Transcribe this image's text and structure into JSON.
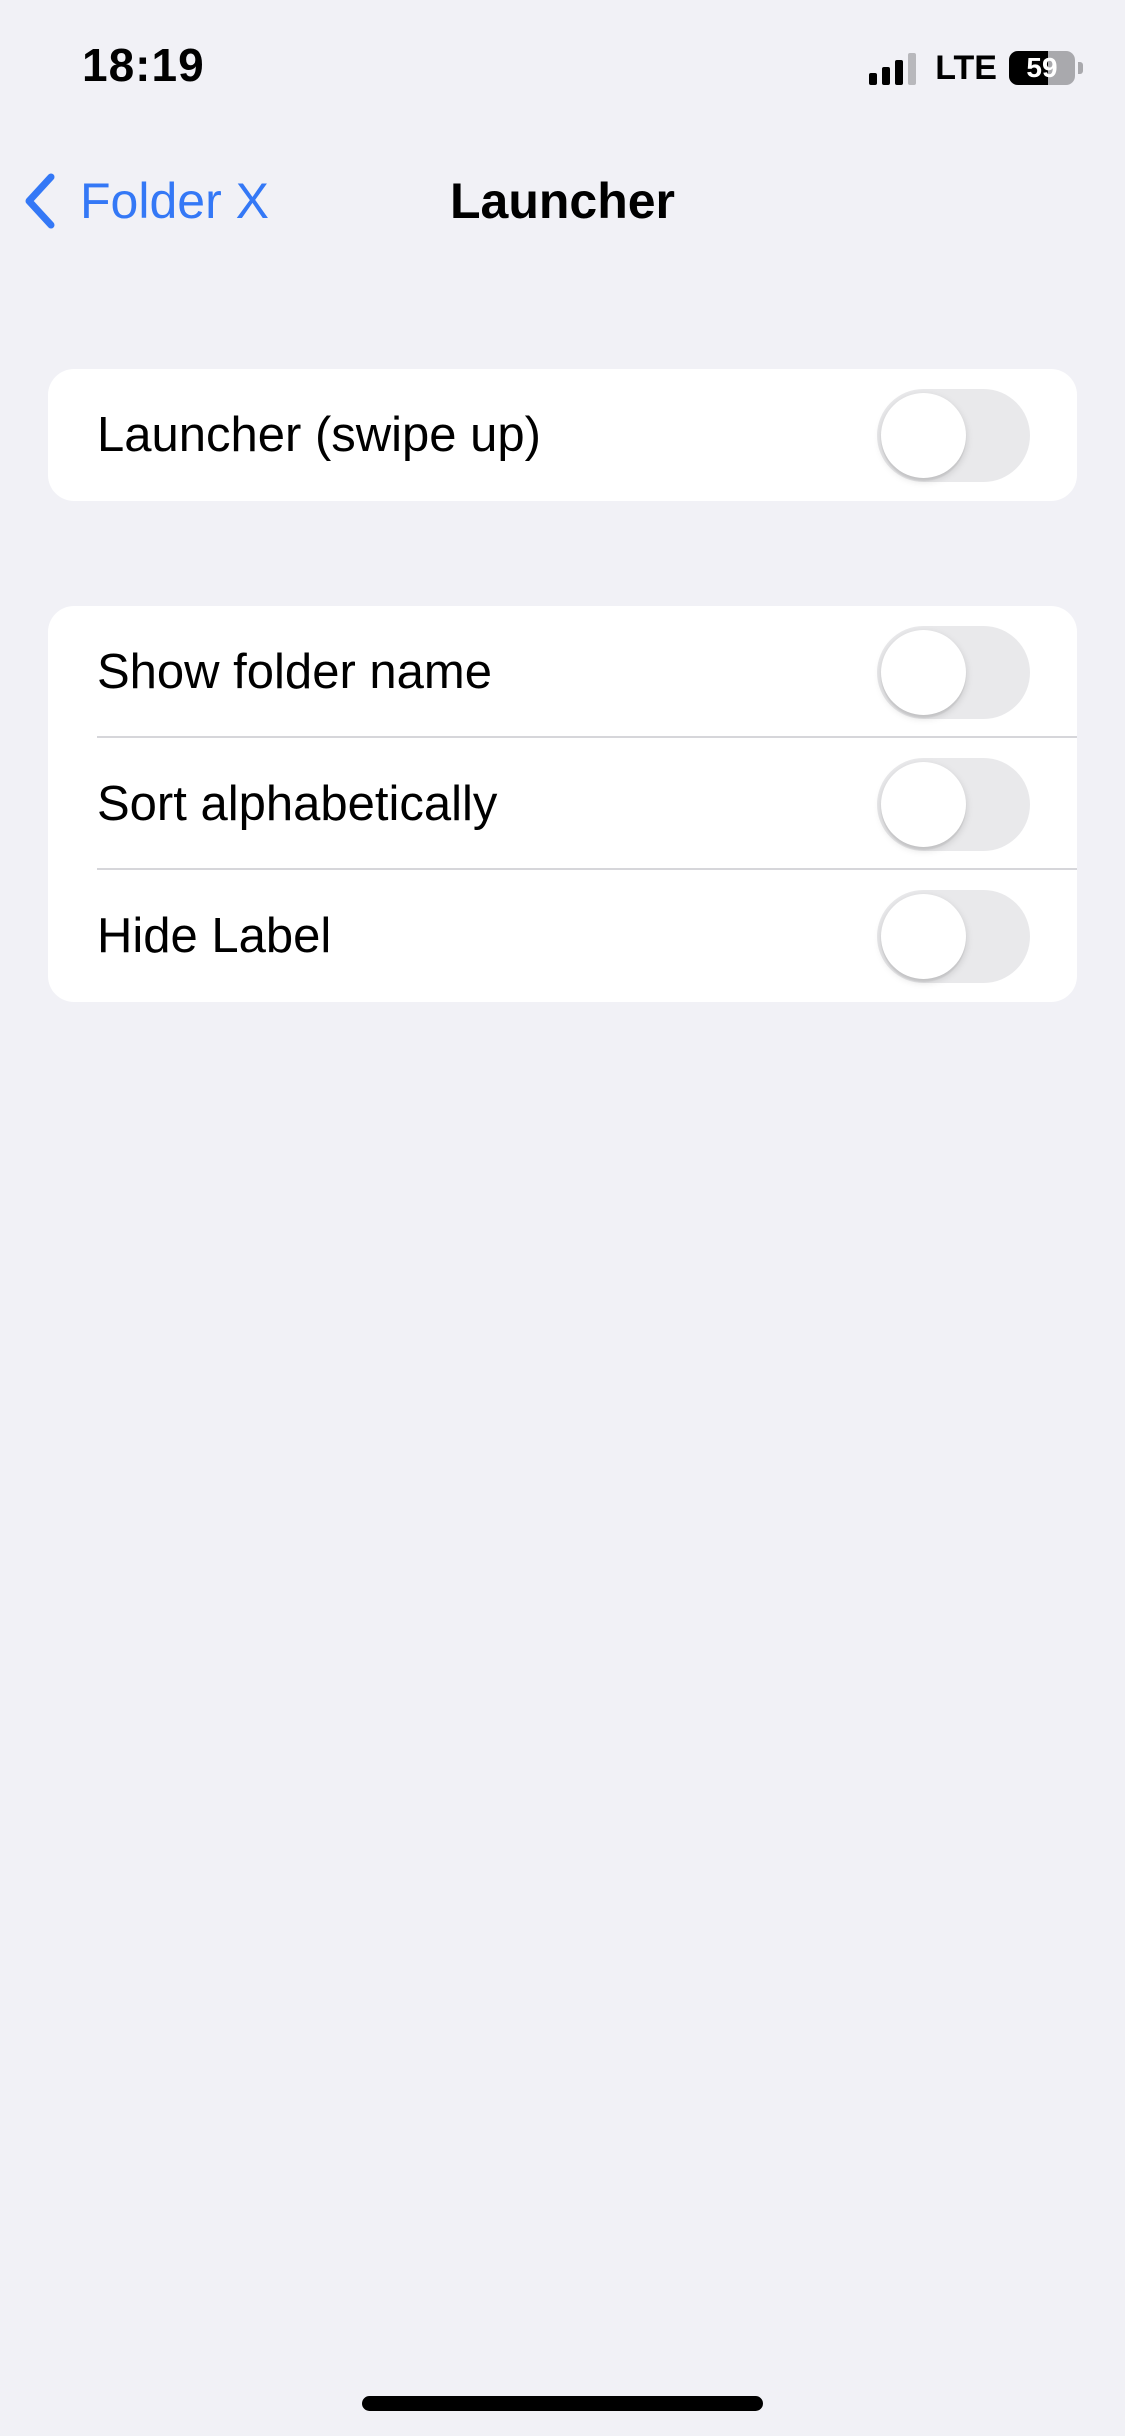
{
  "status_bar": {
    "time": "18:19",
    "network": "LTE",
    "battery_level": "59",
    "battery_fraction": 0.59,
    "signal_bars_active": 3,
    "signal_bars_total": 4,
    "icons": [
      "signal-icon",
      "battery-icon"
    ]
  },
  "nav": {
    "back_label": "Folder X",
    "back_icon": "chevron-left-icon",
    "title": "Launcher"
  },
  "groups": [
    {
      "rows": [
        {
          "label": "Launcher (swipe up)",
          "toggle_on": false
        }
      ]
    },
    {
      "rows": [
        {
          "label": "Show folder name",
          "toggle_on": false
        },
        {
          "label": "Sort alphabetically",
          "toggle_on": false
        },
        {
          "label": "Hide Label",
          "toggle_on": false
        }
      ]
    }
  ],
  "colors": {
    "background": "#f1f1f6",
    "accent": "#3478f6",
    "toggle_off": "#e9e9eb"
  }
}
